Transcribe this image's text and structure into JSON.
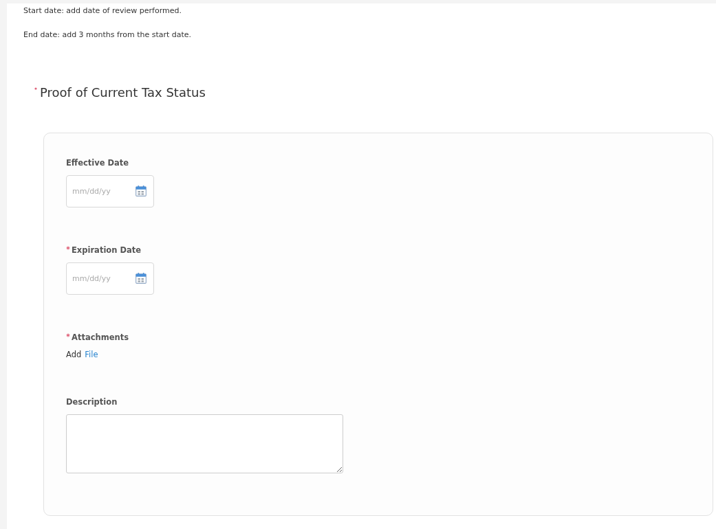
{
  "instructions": [
    "Start date: add date of review performed.",
    "End date: add 3 months from the start date."
  ],
  "section": {
    "title": "Proof of Current Tax Status",
    "required": true,
    "fields": [
      {
        "kind": "date",
        "label": "Effective Date",
        "required": false,
        "placeholder": "mm/dd/yy"
      },
      {
        "kind": "date",
        "label": "Expiration Date",
        "required": true,
        "placeholder": "mm/dd/yy"
      },
      {
        "kind": "attachment",
        "label": "Attachments",
        "required": true,
        "prefix": "Add",
        "link": "File"
      },
      {
        "kind": "textarea",
        "label": "Description",
        "required": false
      }
    ]
  }
}
